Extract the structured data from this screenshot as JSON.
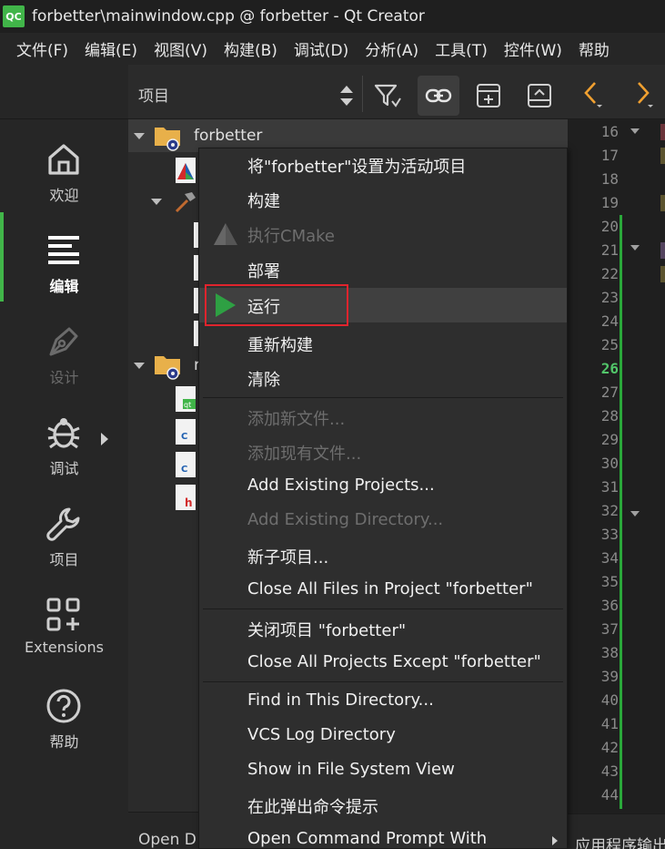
{
  "window": {
    "logo_text": "QC",
    "title": "forbetter\\mainwindow.cpp @ forbetter - Qt Creator"
  },
  "menubar": [
    "文件(F)",
    "编辑(E)",
    "视图(V)",
    "构建(B)",
    "调试(D)",
    "分析(A)",
    "工具(T)",
    "控件(W)",
    "帮助"
  ],
  "tree_toolbar": {
    "label": "项目",
    "icons": [
      "sort-updown-icon",
      "filter-icon",
      "link-icon",
      "add-split-icon",
      "collapse-split-icon"
    ]
  },
  "editor_toolbar": {
    "icons": [
      "back-arrow-icon",
      "forward-arrow-icon"
    ]
  },
  "modebar": [
    {
      "label": "欢迎",
      "icon": "home-icon",
      "state": "normal"
    },
    {
      "label": "编辑",
      "icon": "edit-lines-icon",
      "state": "active"
    },
    {
      "label": "设计",
      "icon": "pen-nib-icon",
      "state": "disabled"
    },
    {
      "label": "调试",
      "icon": "bug-icon",
      "state": "normal"
    },
    {
      "label": "项目",
      "icon": "wrench-icon",
      "state": "normal"
    },
    {
      "label": "Extensions",
      "icon": "extensions-grid-icon",
      "state": "normal"
    },
    {
      "label": "帮助",
      "icon": "help-circle-icon",
      "state": "normal"
    }
  ],
  "tree": {
    "root_label": "forbetter",
    "second_project_initial": "r",
    "bottom_label": "Open D"
  },
  "editor": {
    "line_numbers": [
      "16",
      "17",
      "18",
      "19",
      "20",
      "21",
      "22",
      "23",
      "24",
      "25",
      "26",
      "27",
      "28",
      "29",
      "30",
      "31",
      "32",
      "33",
      "34",
      "35",
      "36",
      "37",
      "38",
      "39",
      "40",
      "41",
      "42",
      "43",
      "44"
    ],
    "current_line": "26",
    "bottom_label": "应用程序输出"
  },
  "context_menu": {
    "items": [
      {
        "label": "将\"forbetter\"设置为活动项目",
        "enabled": true
      },
      {
        "label": "构建",
        "enabled": true
      },
      {
        "label": "执行CMake",
        "enabled": false,
        "icon": "cmake-icon"
      },
      {
        "label": "部署",
        "enabled": true
      },
      {
        "label": "运行",
        "enabled": true,
        "icon": "run-play-icon",
        "highlighted": true
      },
      {
        "label": "重新构建",
        "enabled": true
      },
      {
        "label": "清除",
        "enabled": true
      },
      {
        "label": "添加新文件...",
        "enabled": false
      },
      {
        "label": "添加现有文件...",
        "enabled": false
      },
      {
        "label": "Add Existing Projects...",
        "enabled": true
      },
      {
        "label": "Add Existing Directory...",
        "enabled": false
      },
      {
        "label": "新子项目...",
        "enabled": true
      },
      {
        "label": "Close All Files in Project \"forbetter\"",
        "enabled": true
      },
      {
        "label": "关闭项目 \"forbetter\"",
        "enabled": true
      },
      {
        "label": "Close All Projects Except \"forbetter\"",
        "enabled": true
      },
      {
        "label": "Find in This Directory...",
        "enabled": true
      },
      {
        "label": "VCS Log Directory",
        "enabled": true
      },
      {
        "label": "Show in File System View",
        "enabled": true
      },
      {
        "label": "在此弹出命令提示",
        "enabled": true
      },
      {
        "label": "Open Command Prompt With",
        "enabled": true,
        "submenu": true
      }
    ]
  },
  "colors": {
    "accent_green": "#41b549",
    "highlight_red": "#e0242d",
    "run_green": "#2ea043"
  }
}
